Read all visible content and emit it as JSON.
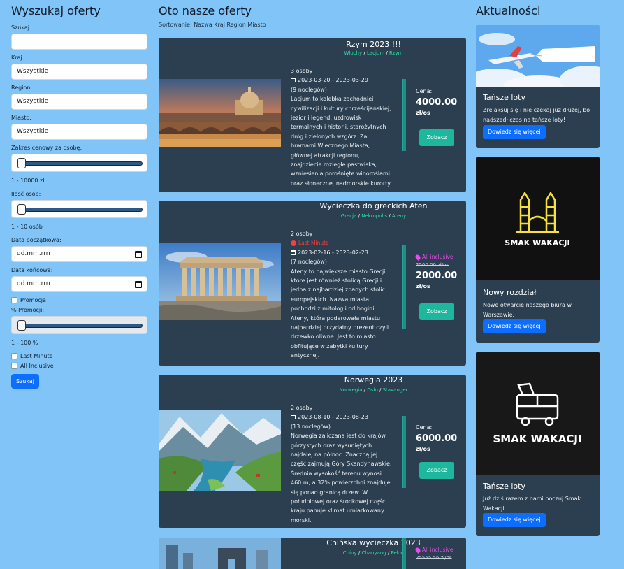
{
  "search": {
    "title": "Wyszukaj oferty",
    "search_label": "Szukaj:",
    "search_value": "",
    "country_label": "Kraj:",
    "country_value": "Wszystkie",
    "region_label": "Region:",
    "region_value": "Wszystkie",
    "city_label": "Miasto:",
    "city_value": "Wszystkie",
    "price_label": "Zakres cenowy za osobę:",
    "price_range": "1 - 10000 zł",
    "persons_label": "Ilość osób:",
    "persons_range": "1 - 10 osób",
    "start_label": "Data początkowa:",
    "start_placeholder": "dd.mm.rrrr",
    "end_label": "Data końcowa:",
    "end_placeholder": "dd.mm.rrrr",
    "promo_label": "Promocja",
    "promo_pct_label": "% Promocji:",
    "promo_range": "1 - 100 %",
    "lastminute_label": "Last Minute",
    "allinclusive_label": "All Inclusive",
    "button": "Szukaj"
  },
  "offers": {
    "title": "Oto nasze oferty",
    "sort": "Sortowanie: Nazwa Kraj Region Miasto",
    "items": [
      {
        "title": "Rzym 2023 !!!",
        "country": "Włochy",
        "region": "Lacjum",
        "city": "Rzym",
        "persons": "3 osoby",
        "dates": "2023-03-20 - 2023-03-29",
        "nights": "(9 noclegów)",
        "description": "Lacjum to kolebka zachodniej cywilizacji i kultury chrześcijańskiej, jezior i legend, uzdrowisk termalnych i historii, starożytnych dróg i zielonych wzgórz. Za bramami Wiecznego Miasta, głównej atrakcji regionu, znajdziecie rozległe pastwiska, wzniesienia porośnięte winoroślami oraz słoneczne, nadmorskie kurorty.",
        "price_label": "Cena:",
        "price": "4000.00",
        "unit": "zł/os",
        "button": "Zobacz"
      },
      {
        "title": "Wycieczka do greckich Aten",
        "country": "Grecja",
        "region": "Nekropolis",
        "city": "Ateny",
        "persons": "2 osoby",
        "last_minute": "Last Minute",
        "dates": "2023-02-16 - 2023-02-23",
        "nights": "(7 noclegów)",
        "description": "Ateny to największe miasto Grecji, które jest również stolicą Grecji i jedna z najbardziej znanych stolic europejskich. Nazwa miasta pochodzi z mitologii od bogini Ateny, która podarowała miastu najbardziej przydatny prezent czyli drzewko oliwne. Jest to miasto obfitujące w zabytki kultury antycznej.",
        "all_inclusive": "All inclusive",
        "old_price": "2500.00 zł/os",
        "price": "2000.00",
        "unit": "zł/os",
        "button": "Zobacz"
      },
      {
        "title": "Norwegia 2023",
        "country": "Norwegia",
        "region": "Oslo",
        "city": "Stavanger",
        "persons": "2 osoby",
        "dates": "2023-08-10 - 2023-08-23",
        "nights": "(13 noclegów)",
        "description": "Norwegia zaliczana jest do krajów górzystych oraz wysuniętych najdalej na północ. Znaczną jej część zajmują Góry Skandynawskie. Średnia wysokość terenu wynosi 460 m, a 32% powierzchni znajduje się ponad granicą drzew. W południowej oraz środkowej części kraju panuje klimat umiarkowany morski.",
        "price_label": "Cena:",
        "price": "6000.00",
        "unit": "zł/os",
        "button": "Zobacz"
      },
      {
        "title": "Chińska wycieczka 2023",
        "country": "Chiny",
        "region": "Chaoyang",
        "city": "Pekin",
        "all_inclusive": "All inclusive",
        "old_price": "25555.56 zł/os"
      }
    ]
  },
  "news": {
    "title": "Aktualności",
    "items": [
      {
        "title": "Tańsze loty",
        "text": "Zrelaksuj się i nie czekaj już dłużej, bo nadszedł czas na tańsze loty!",
        "button": "Dowiedz się więcej"
      },
      {
        "title": "Nowy rozdział",
        "logo_text": "SMAK WAKACJI",
        "text": "Nowe otwarcie naszego biura w Warszawie.",
        "button": "Dowiedz się więcej"
      },
      {
        "title": "Tańsze loty",
        "logo_text": "SMAK WAKACJI",
        "text": "Już dziś razem z nami poczuj Smak Wakacji.",
        "button": "Dowiedz się więcej"
      }
    ]
  },
  "colors": {
    "background": "#80c4f8",
    "card": "#2b3f51",
    "accent_green": "#1cb79d",
    "tag_green": "#2ee0a4",
    "primary_blue": "#0d6efd",
    "all_inclusive": "#e84ce8",
    "last_minute": "#ff3b3b"
  }
}
